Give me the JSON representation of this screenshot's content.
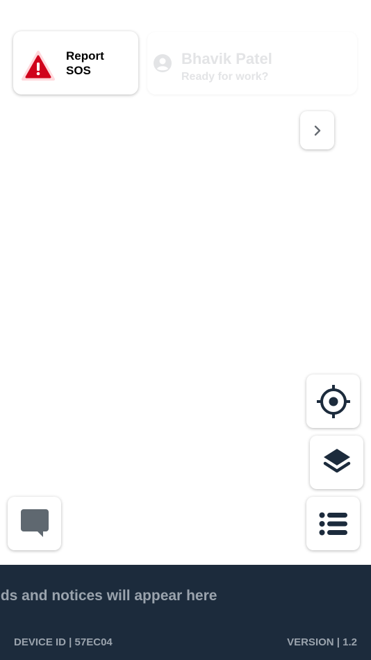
{
  "sos_card": {
    "label": "Report SOS",
    "icon": "warning-triangle-icon",
    "icon_color": "#d0021b"
  },
  "user_card": {
    "name": "Bhavik Patel",
    "status": "Ready for work?",
    "icon": "user-circle-icon"
  },
  "nav": {
    "next_icon": "chevron-right-icon"
  },
  "map_controls": {
    "locate_icon": "crosshair-icon",
    "layers_icon": "layers-icon",
    "list_icon": "list-icon",
    "chat_icon": "chat-bubble-icon"
  },
  "footer": {
    "ticker_text": "nds and notices will appear here",
    "device_id": "DEVICE ID | 57EC04",
    "version": "VERSION | 1.2",
    "background": "#1c2b3c"
  }
}
